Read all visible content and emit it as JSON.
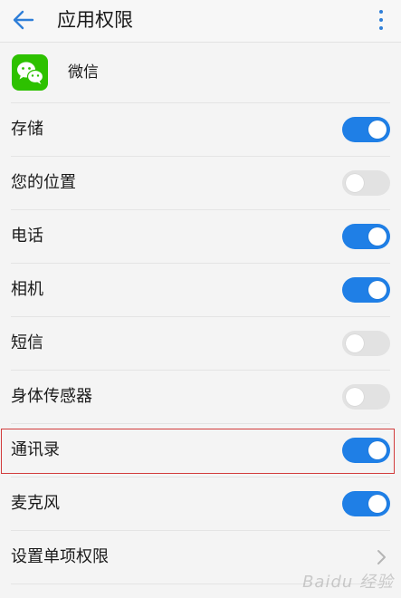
{
  "header": {
    "title": "应用权限",
    "back_icon": "arrow-left-icon",
    "more_icon": "more-vertical-icon"
  },
  "app": {
    "name": "微信",
    "icon": "wechat-icon",
    "icon_color": "#2dc100"
  },
  "permissions": [
    {
      "label": "存储",
      "enabled": true
    },
    {
      "label": "您的位置",
      "enabled": false
    },
    {
      "label": "电话",
      "enabled": true
    },
    {
      "label": "相机",
      "enabled": true
    },
    {
      "label": "短信",
      "enabled": false
    },
    {
      "label": "身体传感器",
      "enabled": false
    },
    {
      "label": "通讯录",
      "enabled": true,
      "highlighted": true
    },
    {
      "label": "麦克风",
      "enabled": true
    }
  ],
  "settings_item": {
    "label": "设置单项权限",
    "icon": "chevron-right-icon"
  },
  "colors": {
    "accent": "#1f7fe6",
    "toggle_off": "#e2e2e2",
    "highlight": "#d23c3c"
  },
  "watermark": "Baidu 经验"
}
